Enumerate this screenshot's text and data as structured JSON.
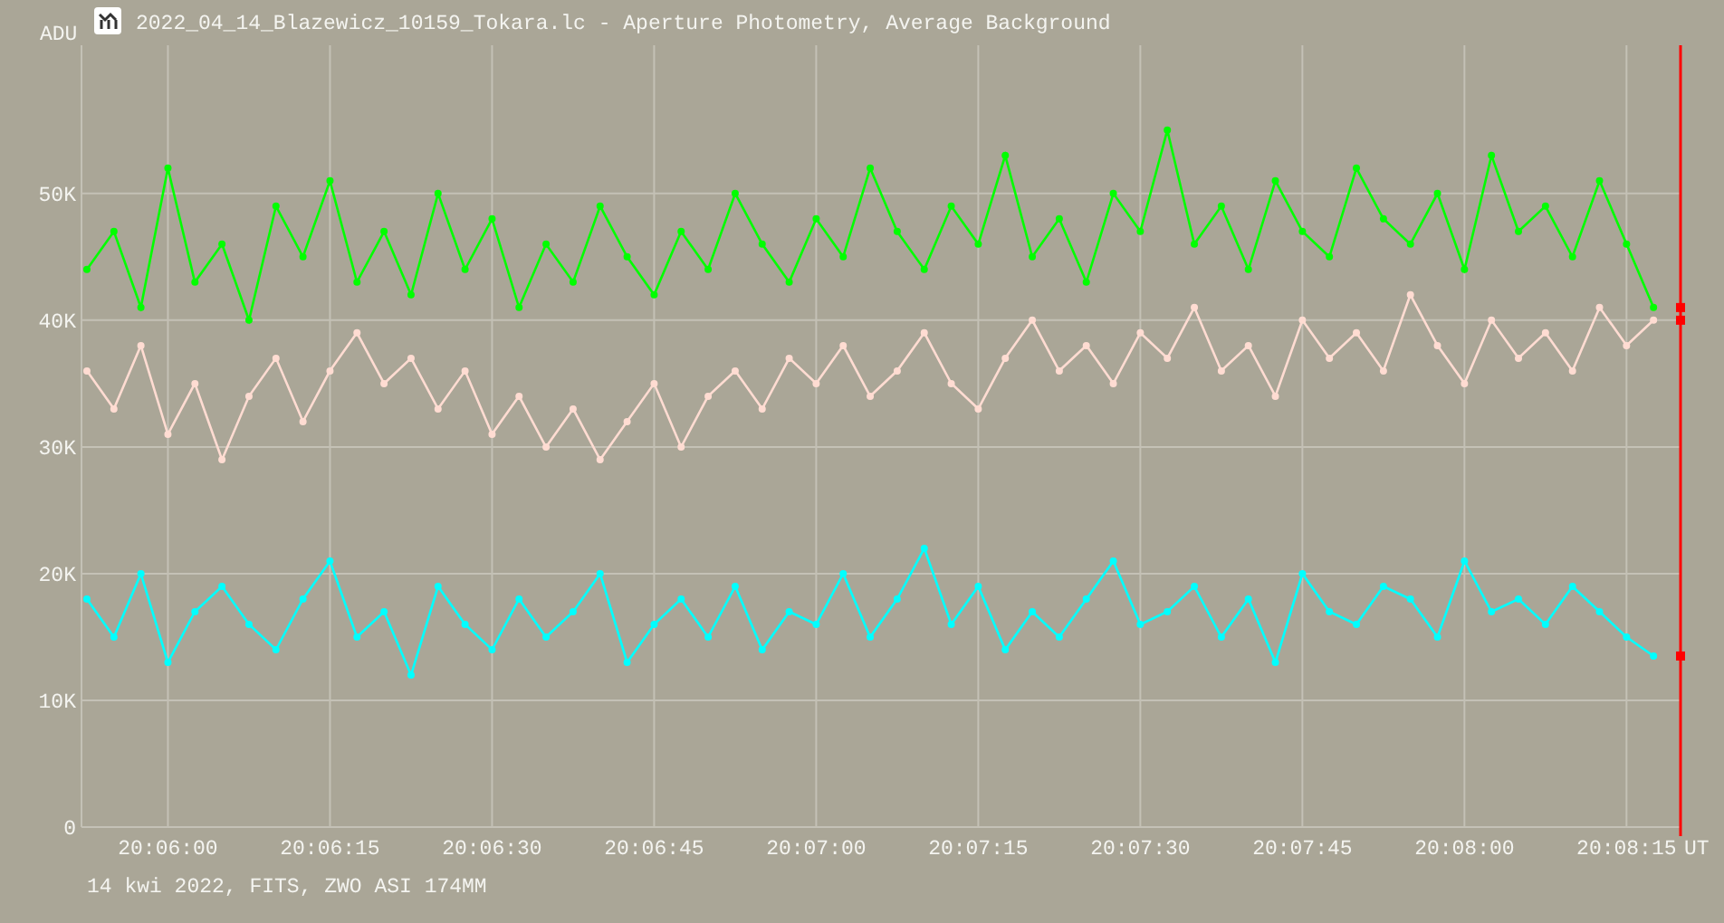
{
  "chart_data": {
    "type": "line",
    "title": "2022_04_14_Blazewicz_10159_Tokara.lc - Aperture Photometry, Average Background",
    "xlabel": "UT",
    "ylabel": "ADU",
    "grid": true,
    "categories": [
      null,
      null,
      null,
      "20:06:00",
      null,
      null,
      null,
      null,
      null,
      "20:06:15",
      null,
      null,
      null,
      null,
      null,
      "20:06:30",
      null,
      null,
      null,
      null,
      null,
      "20:06:45",
      null,
      null,
      null,
      null,
      null,
      "20:07:00",
      null,
      null,
      null,
      null,
      null,
      "20:07:15",
      null,
      null,
      null,
      null,
      null,
      "20:07:30",
      null,
      null,
      null,
      null,
      null,
      "20:07:45",
      null,
      null,
      null,
      null,
      null,
      "20:08:00",
      null,
      null,
      null,
      null,
      null,
      "20:08:15",
      null
    ],
    "series": [
      {
        "color": "#00ff00",
        "marker": "circle",
        "values": [
          44000,
          47000,
          41000,
          52000,
          43000,
          46000,
          40000,
          49000,
          45000,
          51000,
          43000,
          47000,
          42000,
          50000,
          44000,
          48000,
          41000,
          46000,
          43000,
          49000,
          45000,
          42000,
          47000,
          44000,
          50000,
          46000,
          43000,
          48000,
          45000,
          52000,
          47000,
          44000,
          49000,
          46000,
          53000,
          45000,
          48000,
          43000,
          50000,
          47000,
          55000,
          46000,
          49000,
          44000,
          51000,
          47000,
          45000,
          52000,
          48000,
          46000,
          50000,
          44000,
          53000,
          47000,
          49000,
          45000,
          51000,
          46000,
          41000
        ]
      },
      {
        "color": "#ffdcd2",
        "marker": "circle",
        "values": [
          36000,
          33000,
          38000,
          31000,
          35000,
          29000,
          34000,
          37000,
          32000,
          36000,
          39000,
          35000,
          37000,
          33000,
          36000,
          31000,
          34000,
          30000,
          33000,
          29000,
          32000,
          35000,
          30000,
          34000,
          36000,
          33000,
          37000,
          35000,
          38000,
          34000,
          36000,
          39000,
          35000,
          33000,
          37000,
          40000,
          36000,
          38000,
          35000,
          39000,
          37000,
          41000,
          36000,
          38000,
          34000,
          40000,
          37000,
          39000,
          36000,
          42000,
          38000,
          35000,
          40000,
          37000,
          39000,
          36000,
          41000,
          38000,
          40000
        ]
      },
      {
        "color": "#00ffff",
        "marker": "circle",
        "values": [
          18000,
          15000,
          20000,
          13000,
          17000,
          19000,
          16000,
          14000,
          18000,
          21000,
          15000,
          17000,
          12000,
          19000,
          16000,
          14000,
          18000,
          15000,
          17000,
          20000,
          13000,
          16000,
          18000,
          15000,
          19000,
          14000,
          17000,
          16000,
          20000,
          15000,
          18000,
          22000,
          16000,
          19000,
          14000,
          17000,
          15000,
          18000,
          21000,
          16000,
          17000,
          19000,
          15000,
          18000,
          13000,
          20000,
          17000,
          16000,
          19000,
          18000,
          15000,
          21000,
          17000,
          18000,
          16000,
          19000,
          17000,
          15000,
          13500
        ]
      }
    ],
    "ylim": [
      0,
      61700
    ],
    "yticks": [
      {
        "value": 0,
        "label": "0"
      },
      {
        "value": 10000,
        "label": "10K"
      },
      {
        "value": 20000,
        "label": "20K"
      },
      {
        "value": 30000,
        "label": "30K"
      },
      {
        "value": 40000,
        "label": "40K"
      },
      {
        "value": 50000,
        "label": "50K"
      }
    ]
  },
  "footer": "14 kwi 2022, FITS, ZWO ASI 174MM"
}
